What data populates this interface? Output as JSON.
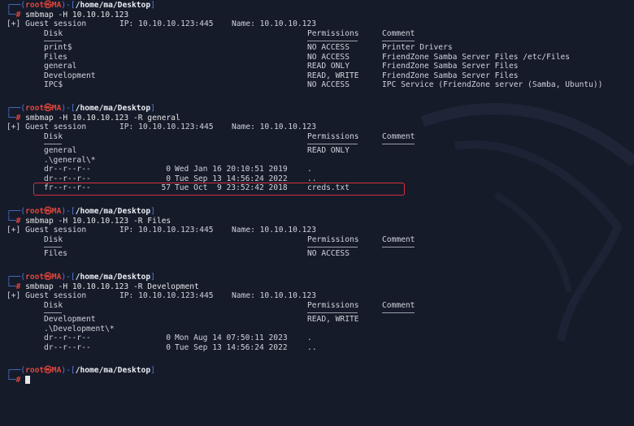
{
  "prompt": {
    "user": "root",
    "sep": "㉿",
    "host": "MA",
    "symbol": "#"
  },
  "blocks": [
    {
      "cwd": "/home/ma/Desktop",
      "command_tool": "smbmap",
      "command_args": "-H 10.10.10.123",
      "session": "[+] Guest session",
      "ip": "IP: 10.10.10.123:445",
      "name": "Name: 10.10.10.123",
      "hdr_disk": "Disk",
      "hdr_perm": "Permissions",
      "hdr_comment": "Comment",
      "shares": [
        {
          "disk": "print$",
          "perm": "NO ACCESS",
          "comment": "Printer Drivers"
        },
        {
          "disk": "Files",
          "perm": "NO ACCESS",
          "comment": "FriendZone Samba Server Files /etc/Files"
        },
        {
          "disk": "general",
          "perm": "READ ONLY",
          "comment": "FriendZone Samba Server Files"
        },
        {
          "disk": "Development",
          "perm": "READ, WRITE",
          "comment": "FriendZone Samba Server Files"
        },
        {
          "disk": "IPC$",
          "perm": "NO ACCESS",
          "comment": "IPC Service (FriendZone server (Samba, Ubuntu))"
        }
      ]
    },
    {
      "cwd": "/home/ma/Desktop",
      "command_tool": "smbmap",
      "command_args": "-H 10.10.10.123 -R general",
      "session": "[+] Guest session",
      "ip": "IP: 10.10.10.123:445",
      "name": "Name: 10.10.10.123",
      "hdr_disk": "Disk",
      "hdr_perm": "Permissions",
      "hdr_comment": "Comment",
      "share": {
        "disk": "general",
        "perm": "READ ONLY"
      },
      "listing_path": ".\\general\\*",
      "entries": [
        {
          "mode": "dr--r--r--",
          "size": "0",
          "date": "Wed Jan 16 20:10:51 2019",
          "name": "."
        },
        {
          "mode": "dr--r--r--",
          "size": "0",
          "date": "Tue Sep 13 14:56:24 2022",
          "name": ".."
        },
        {
          "mode": "fr--r--r--",
          "size": "57",
          "date": "Tue Oct  9 23:52:42 2018",
          "name": "creds.txt"
        }
      ]
    },
    {
      "cwd": "/home/ma/Desktop",
      "command_tool": "smbmap",
      "command_args": "-H 10.10.10.123 -R Files",
      "session": "[+] Guest session",
      "ip": "IP: 10.10.10.123:445",
      "name": "Name: 10.10.10.123",
      "hdr_disk": "Disk",
      "hdr_perm": "Permissions",
      "hdr_comment": "Comment",
      "share": {
        "disk": "Files",
        "perm": "NO ACCESS"
      }
    },
    {
      "cwd": "/home/ma/Desktop",
      "command_tool": "smbmap",
      "command_args": "-H 10.10.10.123 -R Development",
      "session": "[+] Guest session",
      "ip": "IP: 10.10.10.123:445",
      "name": "Name: 10.10.10.123",
      "hdr_disk": "Disk",
      "hdr_perm": "Permissions",
      "hdr_comment": "Comment",
      "share": {
        "disk": "Development",
        "perm": "READ, WRITE"
      },
      "listing_path": ".\\Development\\*",
      "entries": [
        {
          "mode": "dr--r--r--",
          "size": "0",
          "date": "Mon Aug 14 07:50:11 2023",
          "name": "."
        },
        {
          "mode": "dr--r--r--",
          "size": "0",
          "date": "Tue Sep 13 14:56:24 2022",
          "name": ".."
        }
      ]
    },
    {
      "cwd": "/home/ma/Desktop"
    }
  ],
  "colors": {
    "background": "#161b2a",
    "prompt_frame": "#4f7bd8",
    "prompt_user": "#e0463c",
    "highlight_box": "#d4313d"
  }
}
